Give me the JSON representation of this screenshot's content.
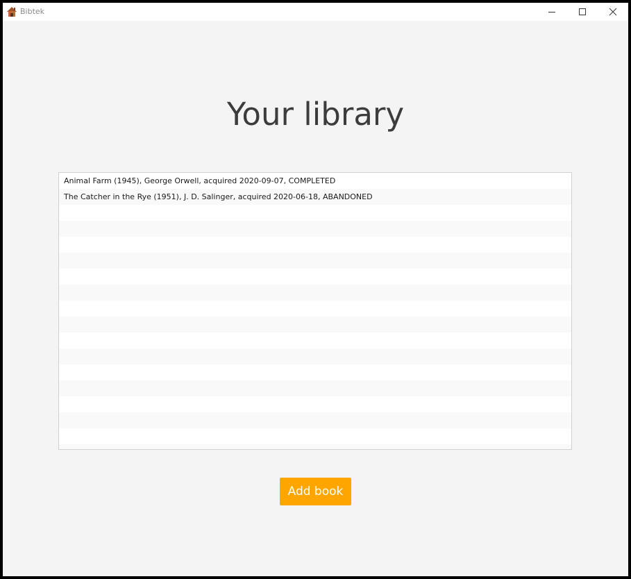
{
  "window": {
    "title": "Bibtek",
    "app_icon": "house-icon",
    "controls": [
      "minimize-icon",
      "maximize-icon",
      "close-icon"
    ]
  },
  "main": {
    "heading": "Your library",
    "books": [
      "Animal Farm (1945), George Orwell, acquired 2020-09-07, COMPLETED",
      "The Catcher in the Rye (1951), J. D. Salinger, acquired 2020-06-18, ABANDONED"
    ],
    "add_button_label": "Add book"
  },
  "colors": {
    "accent": "#ffa500",
    "heading": "#3c3c3c",
    "background": "#f4f4f4",
    "list_alt_row": "#f9f9f9"
  }
}
